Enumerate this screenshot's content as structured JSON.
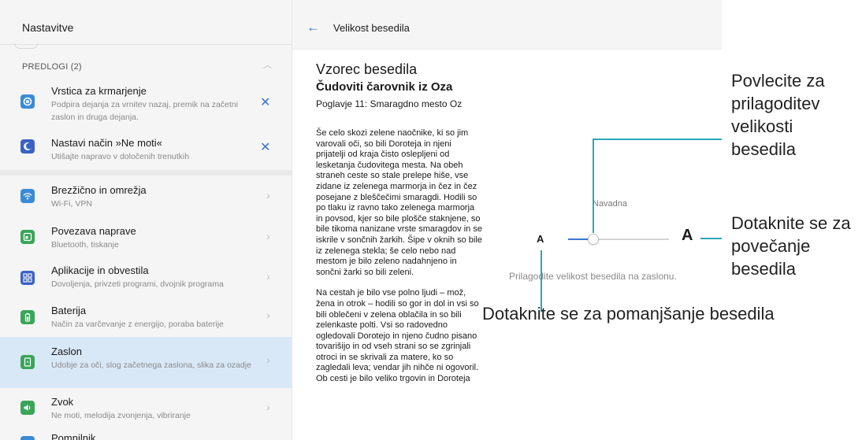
{
  "left_panel": {
    "title": "Nastavitve",
    "section_label": "PREDLOGI (2)",
    "section_chevron": "︿",
    "suggestions": [
      {
        "title": "Vrstica za krmarjenje",
        "subtitle": "Podpira dejanja za vrnitev nazaj, premik na začetni zaslon in druga dejanja.",
        "dismiss": "✕",
        "icon": "navigation-bar-icon",
        "color": "#3a8bd6"
      },
      {
        "title": "Nastavi način »Ne moti«",
        "subtitle": "Utišajte napravo v določenih trenutkih",
        "dismiss": "✕",
        "icon": "moon-icon",
        "color": "#3a62c6"
      }
    ],
    "items": [
      {
        "title": "Brezžično in omrežja",
        "subtitle": "Wi-Fi, VPN",
        "icon": "wifi-icon",
        "color": "#3a8bd6"
      },
      {
        "title": "Povezava naprave",
        "subtitle": "Bluetooth, tiskanje",
        "icon": "device-connection-icon",
        "color": "#3aa55a"
      },
      {
        "title": "Aplikacije in obvestila",
        "subtitle": "Dovoljenja, privzeti programi, dvojnik programa",
        "icon": "apps-icon",
        "color": "#3a62c6"
      },
      {
        "title": "Baterija",
        "subtitle": "Način za varčevanje z energijo, poraba baterije",
        "icon": "battery-icon",
        "color": "#3aa55a"
      },
      {
        "title": "Zaslon",
        "subtitle": "Udobje za oči, slog začetnega zaslona, slika za ozadje",
        "icon": "display-icon",
        "color": "#3aa55a",
        "selected": true
      },
      {
        "title": "Zvok",
        "subtitle": "Ne moti, melodija zvonjenja, vibriranje",
        "icon": "sound-icon",
        "color": "#3aa55a"
      },
      {
        "title": "Pomnilnik",
        "subtitle": "",
        "icon": "storage-icon",
        "color": "#3a8bd6"
      }
    ]
  },
  "right_panel": {
    "title": "Velikost besedila",
    "sample_heading": "Vzorec besedila",
    "book_title": "Čudoviti čarovnik iz Oza",
    "chapter": "Poglavje 11: Smaragdno mesto Oz",
    "paragraphs": [
      "Še celo skozi zelene naočnike, ki so jim varovali oči, so bili Doroteja in njeni prijatelji od kraja čisto oslepljeni od lesketanja čudovitega mesta. Na obeh straneh ceste so stale prelepe hiše, vse zidane iz zelenega marmorja in čez in čez posejane z bleščečimi smaragdi. Hodili so po tlaku iz ravno tako zelenega marmorja in povsod, kjer so bile plošče staknjene, so bile tikoma nanizane vrste smaragdov in se iskrile v sončnih žarkih. Šipe v oknih so bile iz zelenega stekla; še celo nebo nad mestom je bilo zeleno nadahnjeno in sončni žarki so bili zeleni.",
      "Na cestah je bilo vse polno ljudi – mož, žena in otrok – hodili so gor in dol in vsi so bili oblečeni v zelena oblačila in so bili zelenkaste polti. Vsi so radovedno ogledovali Dorotejo in njeno čudno pisano tovarišijo in od vseh strani so se zgrinjali otroci in se skrivali za matere, ko so zagledali leva; vendar jih nihče ni ogovoril. Ob cesti je bilo veliko trgovin in Doroteja"
    ],
    "size_label": "Navadna",
    "small_a": "A",
    "large_a": "A",
    "slider_value": 0.25,
    "hint": "Prilagodite velikost besedila na zaslonu."
  },
  "callouts": {
    "drag": "Povlecite za prilagoditev velikosti besedila",
    "increase": "Dotaknite se za povečanje besedila",
    "decrease": "Dotaknite se za pomanjšanje besedila"
  }
}
